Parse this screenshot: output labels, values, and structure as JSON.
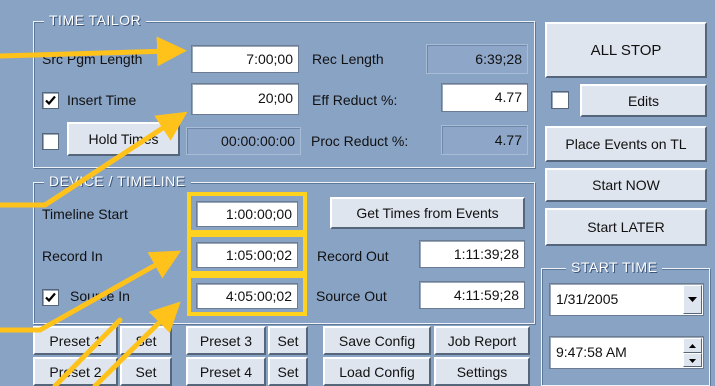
{
  "time_tailor": {
    "title": "TIME TAILOR",
    "src_pgm_length_label": "Src Pgm Length",
    "src_pgm_length_value": "7:00;00",
    "rec_length_label": "Rec Length",
    "rec_length_value": "6:39;28",
    "insert_time_label": "Insert Time",
    "insert_time_value": "20;00",
    "insert_time_checked": true,
    "eff_reduct_label": "Eff Reduct %:",
    "eff_reduct_value": "4.77",
    "hold_times_label": "Hold Times",
    "hold_times_checked": false,
    "hold_time_value": "00:00:00:00",
    "proc_reduct_label": "Proc Reduct %:",
    "proc_reduct_value": "4.77"
  },
  "device_timeline": {
    "title": "DEVICE / TIMELINE",
    "timeline_start_label": "Timeline Start",
    "timeline_start_value": "1:00:00;00",
    "get_times_label": "Get Times from Events",
    "record_in_label": "Record In",
    "record_in_value": "1:05:00;02",
    "record_out_label": "Record Out",
    "record_out_value": "1:11:39;28",
    "source_in_label": "Source In",
    "source_in_checked": true,
    "source_in_value": "4:05:00;02",
    "source_out_label": "Source Out",
    "source_out_value": "4:11:59;28"
  },
  "bottom_buttons": {
    "preset1": "Preset 1",
    "set1": "Set",
    "preset3": "Preset 3",
    "set3": "Set",
    "save_config": "Save Config",
    "job_report": "Job Report",
    "preset2": "Preset 2",
    "set2": "Set",
    "preset4": "Preset 4",
    "set4": "Set",
    "load_config": "Load Config",
    "settings": "Settings"
  },
  "right_panel": {
    "all_stop": "ALL STOP",
    "edits": "Edits",
    "edits_checked": false,
    "place_events": "Place Events on TL",
    "start_now": "Start NOW",
    "start_later": "Start LATER",
    "start_time_title": "START TIME",
    "date_value": "1/31/2005",
    "time_value": "9:47:58 AM"
  },
  "colors": {
    "background": "#89a3c5",
    "highlight": "#ffd21f",
    "arrow": "#ffc21a"
  }
}
